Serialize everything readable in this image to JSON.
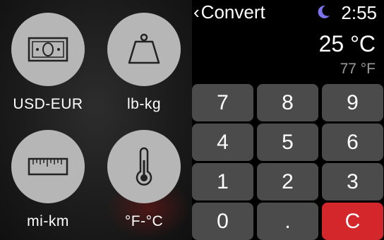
{
  "menu": {
    "items": [
      {
        "label": "USD-EUR",
        "icon": "banknote-icon"
      },
      {
        "label": "lb-kg",
        "icon": "weight-icon"
      },
      {
        "label": "mi-km",
        "icon": "ruler-icon"
      },
      {
        "label": "°F-°C",
        "icon": "thermometer-icon"
      }
    ]
  },
  "header": {
    "back_label": "Convert",
    "time": "2:55",
    "status_icon": "moon-icon"
  },
  "result": {
    "main": "25 °C",
    "sub": "77 °F"
  },
  "keypad": {
    "keys": [
      "7",
      "8",
      "9",
      "4",
      "5",
      "6",
      "1",
      "2",
      "3",
      "0",
      ".",
      "C"
    ]
  },
  "colors": {
    "key_bg": "#4b4b4b",
    "clear_bg": "#d3272b",
    "moon": "#7b74f0",
    "tile_bg": "#b6b6b6"
  }
}
